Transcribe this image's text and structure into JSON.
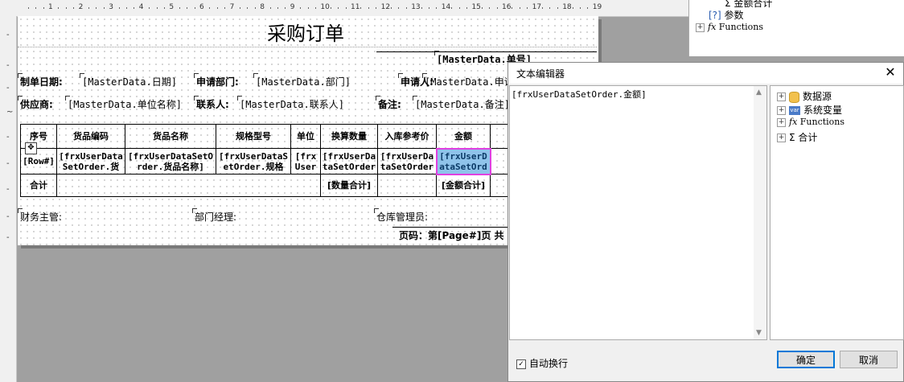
{
  "ruler": {
    "numbers": [
      "1",
      "2",
      "3",
      "4",
      "5",
      "6",
      "7",
      "8",
      "9",
      "10",
      "11",
      "12",
      "13",
      "14",
      "15",
      "16",
      "17",
      "18",
      "19"
    ]
  },
  "report": {
    "title": "采购订单",
    "order_no": "[MasterData.单号]",
    "fields": {
      "date_label": "制单日期:",
      "date_value": "[MasterData.日期]",
      "dept_label": "申请部门:",
      "dept_value": "[MasterData.部门]",
      "applicant_label": "申请人:",
      "applicant_value": "[MasterData.申请",
      "supplier_label": "供应商:",
      "supplier_value": "[MasterData.单位名称]",
      "contact_label": "联系人:",
      "contact_value": "[MasterData.联系人]",
      "remark_label": "备注:",
      "remark_value": "[MasterData.备注]"
    },
    "table": {
      "headers": [
        "序号",
        "货品编码",
        "货品名称",
        "规格型号",
        "单位",
        "换算数量",
        "入库参考价",
        "金额"
      ],
      "row": [
        "[Row#]",
        "[frxUserData SetOrder.货",
        "[frxUserDataSetO rder.货品名称]",
        "[frxUserDataS etOrder.规格",
        "[frx User",
        "[frxUserDa taSetOrder",
        "[frxUserDa taSetOrder",
        "[frxUserD ataSetOrd"
      ],
      "total_label": "合计",
      "qty_total": "[数量合计]",
      "amount_total": "[金额合计]"
    },
    "footer": {
      "finance": "财务主管:",
      "manager": "部门经理:",
      "warehouse": "仓库管理员:",
      "page": "页码：第[Page#]页 共"
    }
  },
  "right_panel": {
    "items": [
      "金额合计",
      "参数",
      "Functions"
    ]
  },
  "dialog": {
    "title": "文本编辑器",
    "close": "✕",
    "editor_text": "[frxUserDataSetOrder.金额]",
    "tree": [
      "数据源",
      "系统变量",
      "Functions",
      "合计"
    ],
    "var_icon": "var",
    "autowrap_label": "自动换行",
    "ok": "确定",
    "cancel": "取消"
  },
  "colors": {
    "highlight": "#e040e0",
    "selected_cell": "#8fc3ea",
    "accent": "#0078d7"
  }
}
